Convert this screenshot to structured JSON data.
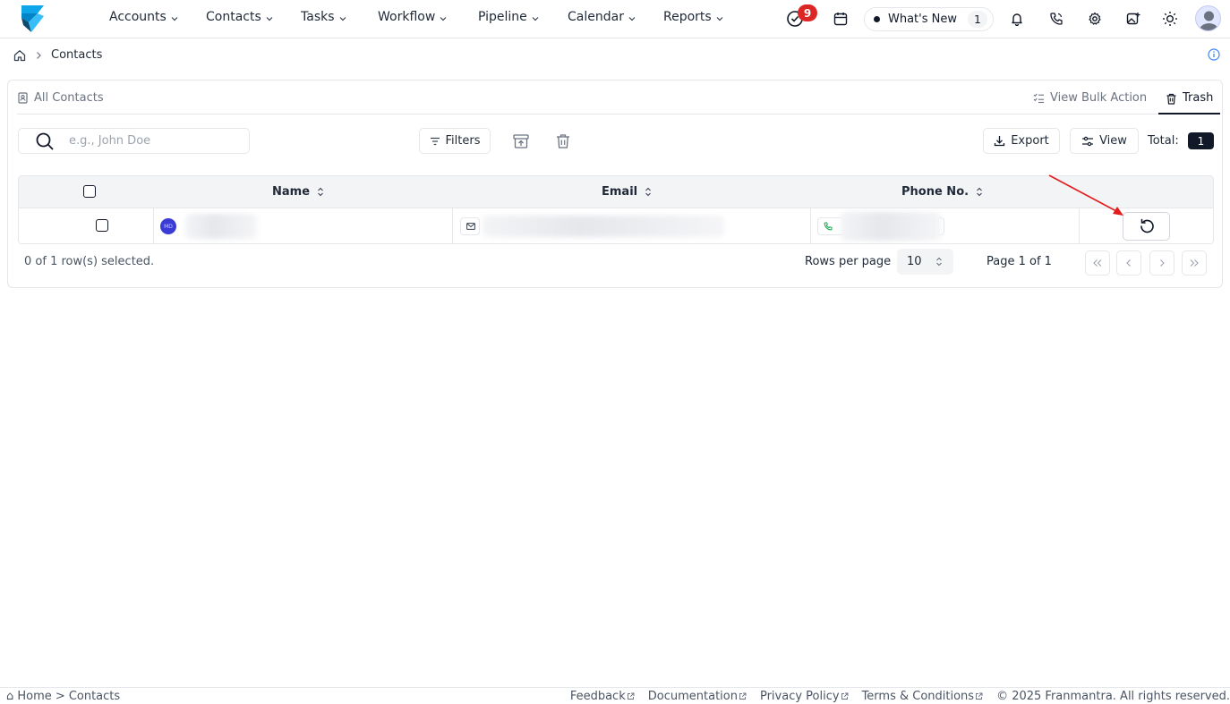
{
  "nav": {
    "items": [
      "Accounts",
      "Contacts",
      "Tasks",
      "Workflow",
      "Pipeline",
      "Calendar",
      "Reports"
    ],
    "task_badge": "9",
    "whats_new_label": "What's New",
    "whats_new_count": "1"
  },
  "breadcrumb": {
    "current": "Contacts"
  },
  "tabs": {
    "all_contacts": "All Contacts",
    "bulk_action": "View Bulk Action",
    "trash": "Trash"
  },
  "toolbar": {
    "search_placeholder": "e.g., John Doe",
    "filters_label": "Filters",
    "export_label": "Export",
    "view_label": "View",
    "total_label": "Total:",
    "total_count": "1"
  },
  "table": {
    "columns": [
      "Name",
      "Email",
      "Phone No."
    ],
    "row_avatar_initials": "MD"
  },
  "pagination": {
    "selected_text": "0 of 1 row(s) selected.",
    "rows_per_page_label": "Rows per page",
    "rows_per_page_value": "10",
    "page_text": "Page 1 of 1"
  },
  "footer": {
    "home": "⌂ Home >",
    "current": "Contacts",
    "links": [
      "Feedback",
      "Documentation",
      "Privacy Policy",
      "Terms & Conditions"
    ],
    "copyright": "© 2025 Franmantra. All rights reserved."
  },
  "colors": {
    "accent": "#111827",
    "badge_red": "#dc2626",
    "logo_blue": "#0ea5e9",
    "avatar_blue": "#3b3bd6",
    "annotation_arrow": "#e11d1d"
  }
}
